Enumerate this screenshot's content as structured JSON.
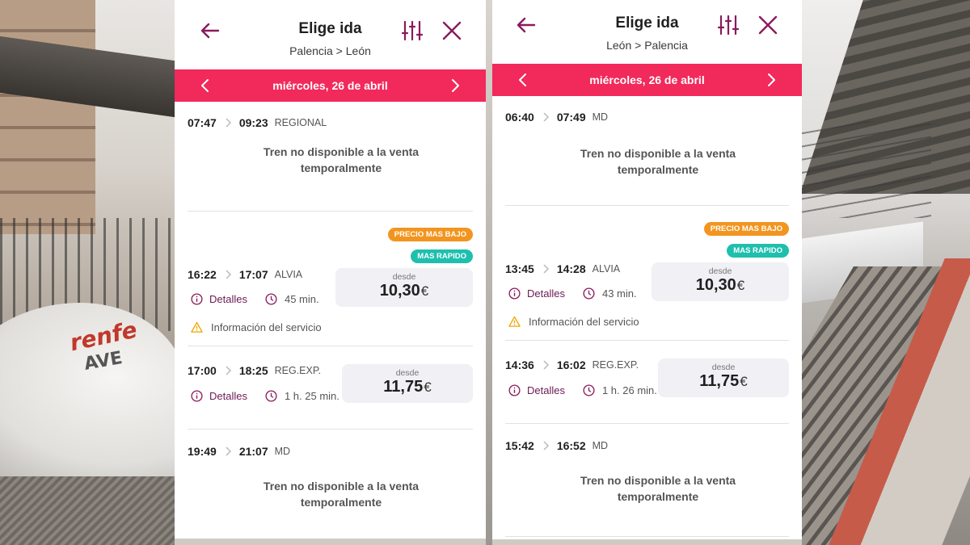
{
  "colors": {
    "accent": "#f2295b",
    "icon": "#8a1a5c",
    "badge_low": "#f2951f",
    "badge_fast": "#1fbfae"
  },
  "panels": [
    {
      "title": "Elige ida",
      "route": "Palencia > León",
      "date": "miércoles, 26 de abril",
      "items": [
        {
          "dep": "07:47",
          "arr": "09:23",
          "type": "REGIONAL",
          "unavailable": "Tren no disponible a la venta temporalmente"
        },
        {
          "badge_low": "PRECIO MAS BAJO",
          "badge_fast": "MAS RAPIDO",
          "dep": "16:22",
          "arr": "17:07",
          "type": "ALVIA",
          "desde": "desde",
          "price": "10,30",
          "currency": "€",
          "details": "Detalles",
          "duration": "45 min.",
          "service_info": "Información del servicio"
        },
        {
          "dep": "17:00",
          "arr": "18:25",
          "type": "REG.EXP.",
          "desde": "desde",
          "price": "11,75",
          "currency": "€",
          "details": "Detalles",
          "duration": "1 h. 25 min."
        },
        {
          "dep": "19:49",
          "arr": "21:07",
          "type": "MD",
          "unavailable": "Tren no disponible a la venta temporalmente"
        }
      ]
    },
    {
      "title": "Elige ida",
      "route": "León > Palencia",
      "date": "miércoles, 26 de abril",
      "items": [
        {
          "dep": "06:40",
          "arr": "07:49",
          "type": "MD",
          "unavailable": "Tren no disponible a la venta temporalmente"
        },
        {
          "badge_low": "PRECIO MAS BAJO",
          "badge_fast": "MAS RAPIDO",
          "dep": "13:45",
          "arr": "14:28",
          "type": "ALVIA",
          "desde": "desde",
          "price": "10,30",
          "currency": "€",
          "details": "Detalles",
          "duration": "43 min.",
          "service_info": "Información del servicio"
        },
        {
          "dep": "14:36",
          "arr": "16:02",
          "type": "REG.EXP.",
          "desde": "desde",
          "price": "11,75",
          "currency": "€",
          "details": "Detalles",
          "duration": "1 h. 26 min."
        },
        {
          "dep": "15:42",
          "arr": "16:52",
          "type": "MD",
          "unavailable": "Tren no disponible a la venta temporalmente"
        }
      ]
    }
  ]
}
